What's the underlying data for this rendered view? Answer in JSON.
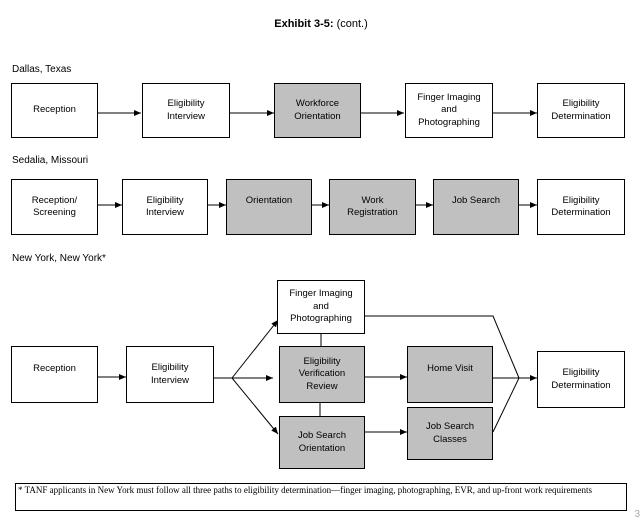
{
  "title": {
    "bold": "Exhibit 3-5:",
    "rest": " (cont.)"
  },
  "sections": [
    {
      "label": "Dallas, Texas",
      "boxes": [
        {
          "label": "Reception",
          "shaded": false
        },
        {
          "label": "Eligibility\nInterview",
          "shaded": false
        },
        {
          "label": "Workforce\nOrientation",
          "shaded": true
        },
        {
          "label": "Finger Imaging\nand\nPhotographing",
          "shaded": false
        },
        {
          "label": "Eligibility\nDetermination",
          "shaded": false
        }
      ]
    },
    {
      "label": "Sedalia, Missouri",
      "boxes": [
        {
          "label": "Reception/\nScreening",
          "shaded": false
        },
        {
          "label": "Eligibility\nInterview",
          "shaded": false
        },
        {
          "label": "Orientation",
          "shaded": true
        },
        {
          "label": "Work\nRegistration",
          "shaded": true
        },
        {
          "label": "Job Search",
          "shaded": true
        },
        {
          "label": "Eligibility\nDetermination",
          "shaded": false
        }
      ]
    },
    {
      "label": "New York, New York*",
      "boxes": [
        {
          "label": "Reception",
          "shaded": false
        },
        {
          "label": "Eligibility\nInterview",
          "shaded": false
        },
        {
          "label": "Finger Imaging\nand\nPhotographing",
          "shaded": false
        },
        {
          "label": "Eligibility\nVerification\nReview",
          "shaded": true
        },
        {
          "label": "Job Search\nOrientation",
          "shaded": true
        },
        {
          "label": "Home Visit",
          "shaded": true
        },
        {
          "label": "Job Search\nClasses",
          "shaded": true
        },
        {
          "label": "Eligibility\nDetermination",
          "shaded": false
        }
      ]
    }
  ],
  "footnote": "* TANF applicants in New York must follow all three paths to eligibility determination—finger imaging, photographing, EVR, and up-front work requirements",
  "page_number": "3"
}
